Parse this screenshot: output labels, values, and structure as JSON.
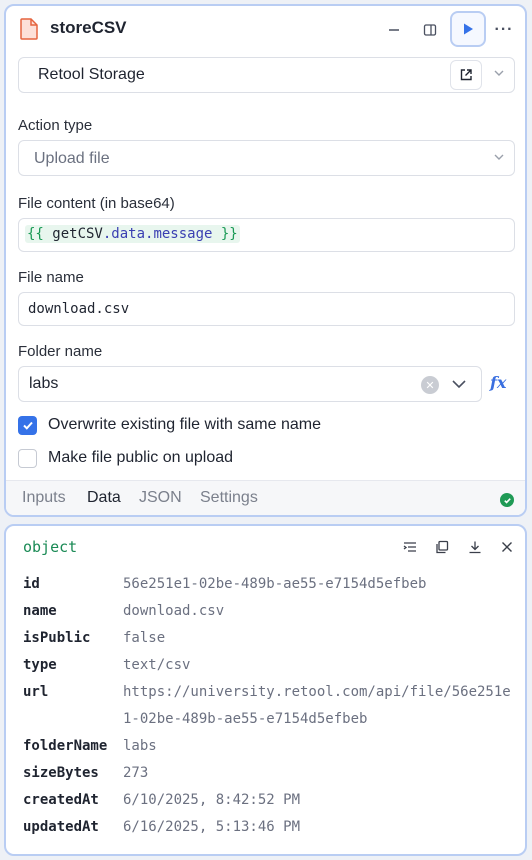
{
  "query": {
    "name": "storeCSV",
    "resource": "Retool Storage",
    "action_type_label": "Action type",
    "action_type_value": "Upload file",
    "file_content_label": "File content (in base64)",
    "file_content_tpl": {
      "open": "{{",
      "ident": " getCSV",
      "prop": ".data.message",
      "close": " }}"
    },
    "file_name_label": "File name",
    "file_name_value": "download.csv",
    "folder_name_label": "Folder name",
    "folder_name_value": "labs",
    "fx_label": "fx",
    "overwrite_label": "Overwrite existing file with same name",
    "overwrite_checked": true,
    "public_label": "Make file public on upload",
    "public_checked": false,
    "tabs": [
      "Inputs",
      "Data",
      "JSON",
      "Settings"
    ],
    "active_tab": "Data",
    "status": "success",
    "accent_color": "#3572e8",
    "success_color": "#1f9a55"
  },
  "result": {
    "type_label": "object",
    "rows": [
      {
        "key": "id",
        "value": "56e251e1-02be-489b-ae55-e7154d5efbeb"
      },
      {
        "key": "name",
        "value": "download.csv"
      },
      {
        "key": "isPublic",
        "value": "false"
      },
      {
        "key": "type",
        "value": "text/csv"
      },
      {
        "key": "url",
        "value": "https://university.retool.com/api/file/56e251e1-02be-489b-ae55-e7154d5efbeb"
      },
      {
        "key": "folderName",
        "value": "labs"
      },
      {
        "key": "sizeBytes",
        "value": "273"
      },
      {
        "key": "createdAt",
        "value": "6/10/2025, 8:42:52 PM"
      },
      {
        "key": "updatedAt",
        "value": "6/16/2025, 5:13:46 PM"
      }
    ]
  }
}
